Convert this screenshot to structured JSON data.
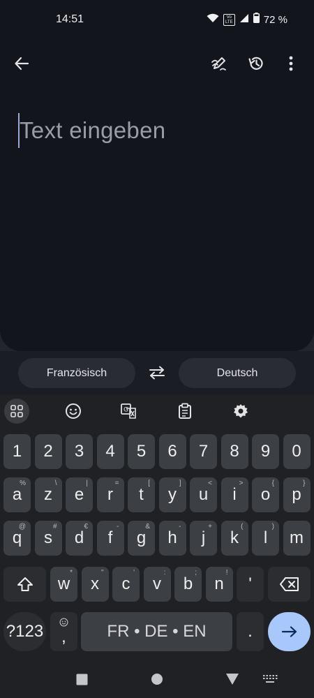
{
  "status_bar": {
    "time": "14:51",
    "volte": "Vo LTE",
    "battery_percent": "72 %"
  },
  "toolbar": {
    "back_icon": "arrow-left-icon",
    "handwriting_icon": "pen-icon",
    "history_icon": "history-icon",
    "more_icon": "more-vert-icon"
  },
  "input": {
    "placeholder": "Text eingeben"
  },
  "languages": {
    "source": "Französisch",
    "target": "Deutsch",
    "swap_icon": "swap-icon"
  },
  "keyboard": {
    "toolbar": [
      "apps-grid-icon",
      "emoji-icon",
      "translate-icon",
      "clipboard-icon",
      "settings-icon"
    ],
    "row_numbers": [
      "1",
      "2",
      "3",
      "4",
      "5",
      "6",
      "7",
      "8",
      "9",
      "0"
    ],
    "row1": [
      {
        "key": "a",
        "hint": "%"
      },
      {
        "key": "z",
        "hint": "\\"
      },
      {
        "key": "e",
        "hint": "|"
      },
      {
        "key": "r",
        "hint": "="
      },
      {
        "key": "t",
        "hint": "["
      },
      {
        "key": "y",
        "hint": "]"
      },
      {
        "key": "u",
        "hint": "<"
      },
      {
        "key": "i",
        "hint": ">"
      },
      {
        "key": "o",
        "hint": "{"
      },
      {
        "key": "p",
        "hint": "}"
      }
    ],
    "row2": [
      {
        "key": "q",
        "hint": "@"
      },
      {
        "key": "s",
        "hint": "#"
      },
      {
        "key": "d",
        "hint": "€"
      },
      {
        "key": "f",
        "hint": "-"
      },
      {
        "key": "g",
        "hint": "&"
      },
      {
        "key": "h",
        "hint": "-"
      },
      {
        "key": "j",
        "hint": "+"
      },
      {
        "key": "k",
        "hint": "("
      },
      {
        "key": "l",
        "hint": ")"
      },
      {
        "key": "m",
        "hint": ""
      }
    ],
    "row3": [
      {
        "key": "w",
        "hint": "*"
      },
      {
        "key": "x",
        "hint": "\""
      },
      {
        "key": "c",
        "hint": "'"
      },
      {
        "key": "v",
        "hint": ":"
      },
      {
        "key": "b",
        "hint": ";"
      },
      {
        "key": "n",
        "hint": "!"
      },
      {
        "key": "'",
        "hint": ""
      }
    ],
    "symbols_label": "?123",
    "comma": ",",
    "space_label": "FR • DE • EN",
    "period": "."
  },
  "accent_color": "#a8c7fa"
}
